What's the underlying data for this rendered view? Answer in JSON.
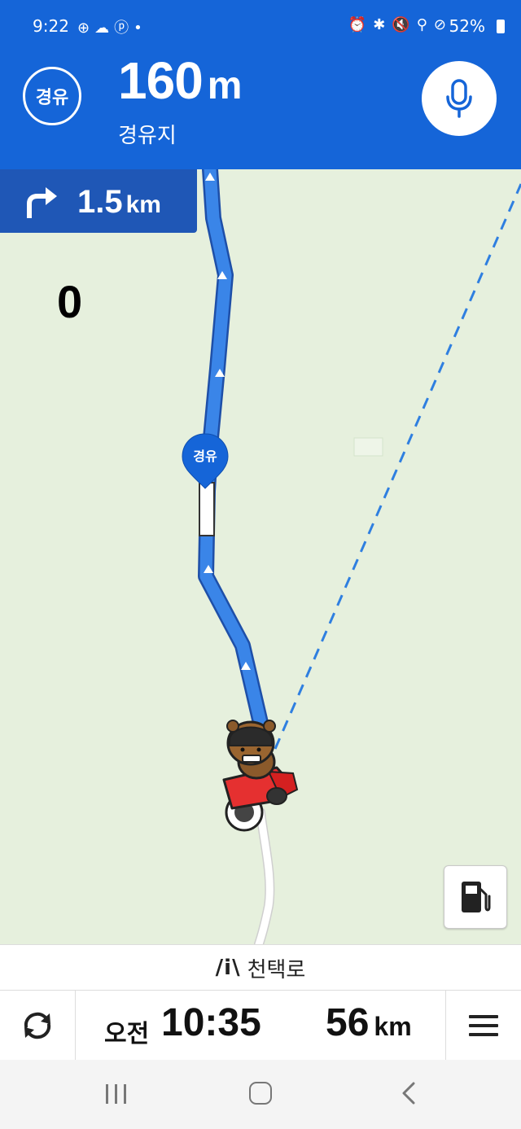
{
  "status_bar": {
    "time": "9:22",
    "left_icons": "⊕☁ⓟ•",
    "right_icons": "⏰✱🔇⚲⊘",
    "battery_percent": "52%"
  },
  "header": {
    "type_badge": "경유",
    "distance_value": "160",
    "distance_unit": "m",
    "destination_name": "경유지",
    "accent_color": "#1565d8"
  },
  "next_turn": {
    "direction_icon": "turn-right-arrow-icon",
    "distance_value": "1.5",
    "distance_unit": "km"
  },
  "overlay_counter": "0",
  "map": {
    "waypoint_marker_label": "경유",
    "route_color": "#3a85e8"
  },
  "road_bar": {
    "road_icon": "/i\\",
    "road_name": "천택로"
  },
  "info_bar": {
    "ampm": "오전",
    "eta_time": "10:35",
    "remaining_distance_value": "56",
    "remaining_distance_unit": "km"
  }
}
